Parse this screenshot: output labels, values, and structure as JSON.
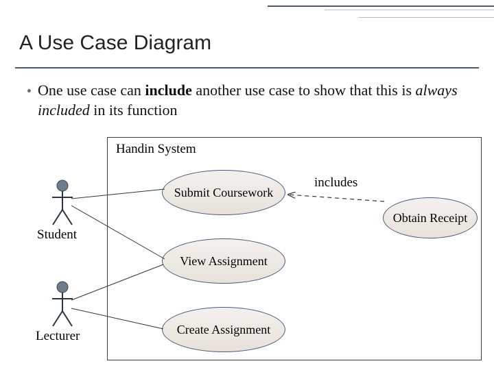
{
  "title": "A Use Case Diagram",
  "bullet": {
    "pre": "One use case can ",
    "include": "include",
    "mid": " another use case to show that this is ",
    "always": "always included",
    "post": " in its function"
  },
  "system_label": "Handin System",
  "actors": {
    "student": "Student",
    "lecturer": "Lecturer"
  },
  "usecases": {
    "submit": "Submit Coursework",
    "view": "View Assignment",
    "create": "Create Assignment",
    "obtain": "Obtain Receipt"
  },
  "includes_label": "includes"
}
